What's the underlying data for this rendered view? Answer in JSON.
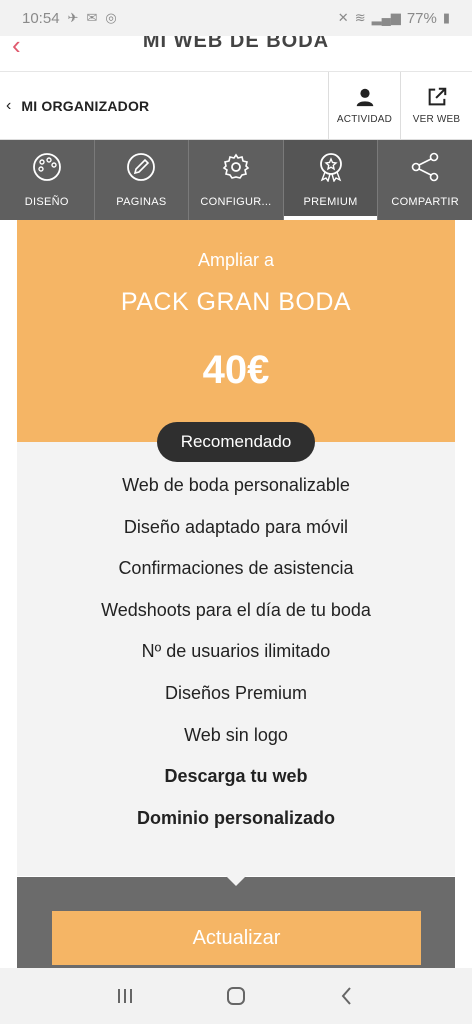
{
  "status_bar": {
    "time": "10:54",
    "battery": "77%"
  },
  "title_bar": {
    "title": "MI WEB DE BODA"
  },
  "organizer_bar": {
    "back_label": "MI ORGANIZADOR",
    "activity_label": "ACTIVIDAD",
    "view_web_label": "VER WEB"
  },
  "tabs": [
    {
      "label": "DISEÑO",
      "icon": "palette-icon"
    },
    {
      "label": "PAGINAS",
      "icon": "pencil-icon"
    },
    {
      "label": "CONFIGUR...",
      "icon": "gear-icon"
    },
    {
      "label": "PREMIUM",
      "icon": "award-icon",
      "active": true
    },
    {
      "label": "COMPARTIR",
      "icon": "share-icon"
    }
  ],
  "pack": {
    "subtitle": "Ampliar a",
    "name": "PACK GRAN BODA",
    "price": "40€",
    "badge": "Recomendado",
    "features": [
      "Web de boda personalizable",
      "Diseño adaptado para móvil",
      "Confirmaciones de asistencia",
      "Wedshoots para el día de tu boda",
      "Nº de usuarios ilimitado",
      "Diseños Premium",
      "Web sin logo",
      "Descarga tu web",
      "Dominio personalizado"
    ],
    "cta": "Actualizar"
  },
  "colors": {
    "accent_orange": "#f5b565",
    "tab_bar": "#5f5f5f",
    "back_arrow": "#e05a6e",
    "badge": "#2f2f2f"
  }
}
